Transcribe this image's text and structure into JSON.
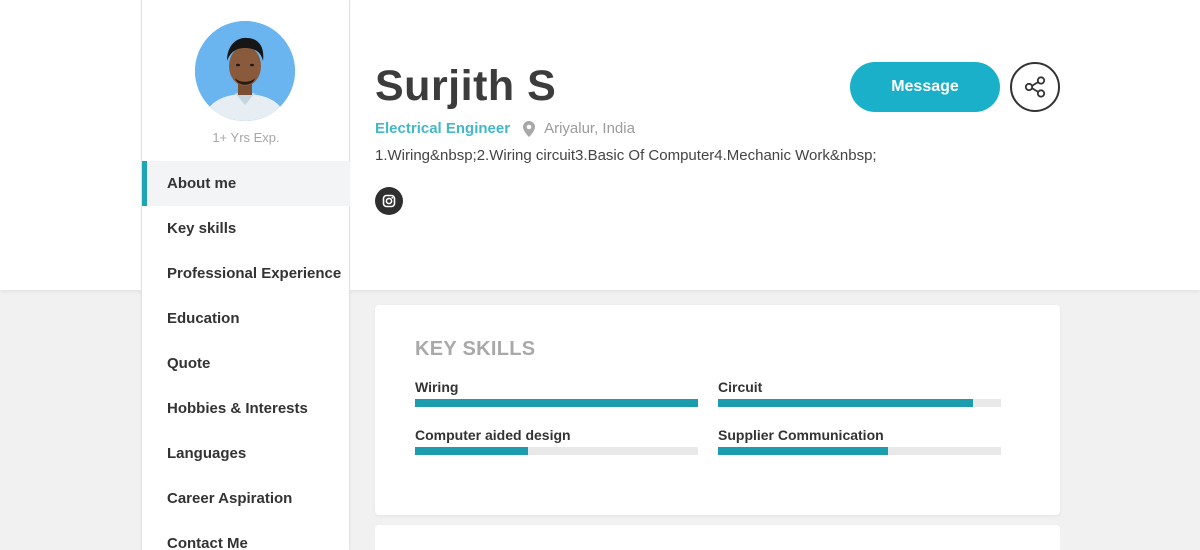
{
  "sidebar": {
    "experience": "1+ Yrs Exp.",
    "items": [
      {
        "label": "About me",
        "active": true
      },
      {
        "label": "Key skills"
      },
      {
        "label": "Professional Experience"
      },
      {
        "label": "Education"
      },
      {
        "label": "Quote"
      },
      {
        "label": "Hobbies & Interests"
      },
      {
        "label": "Languages"
      },
      {
        "label": "Career Aspiration"
      },
      {
        "label": "Contact Me"
      }
    ]
  },
  "profile": {
    "name": "Surjith S",
    "role": "Electrical Engineer",
    "location": "Ariyalur, India",
    "description": "1.Wiring&nbsp;2.Wiring circuit3.Basic Of Computer4.Mechanic Work&nbsp;",
    "social_icon": "instagram-icon"
  },
  "actions": {
    "message_label": "Message",
    "share_icon": "share-icon"
  },
  "key_skills": {
    "title": "KEY SKILLS",
    "skills": [
      {
        "name": "Wiring",
        "level": 1.0
      },
      {
        "name": "Circuit",
        "level": 0.9
      },
      {
        "name": "Computer aided design",
        "level": 0.4
      },
      {
        "name": "Supplier Communication",
        "level": 0.6
      }
    ]
  },
  "colors": {
    "accent": "#1ab0c9",
    "role_text": "#44b8c7",
    "skill_bar": "#1c9dae"
  }
}
